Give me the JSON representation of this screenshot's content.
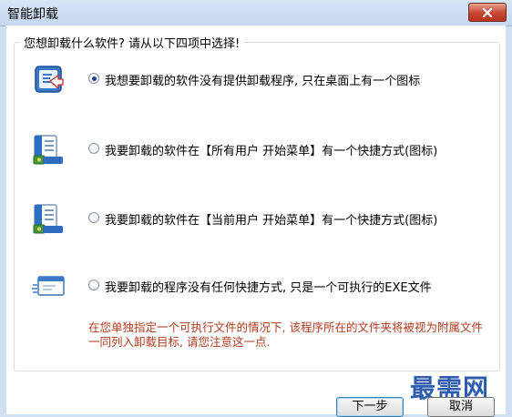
{
  "window": {
    "title": "智能卸载",
    "close_icon": "close-x-icon"
  },
  "dialog": {
    "question": "您想卸载什么软件? 请从以下四项中选择!",
    "options": [
      {
        "label": "我想要卸载的软件没有提供卸载程序, 只在桌面上有一个图标",
        "checked": true,
        "icon": "desktop-shortcut-icon"
      },
      {
        "label": "我要卸载的软件在【所有用户 开始菜单】有一个快捷方式(图标)",
        "checked": false,
        "icon": "start-menu-all-users-icon"
      },
      {
        "label": "我要卸载的软件在【当前用户 开始菜单】有一个快捷方式(图标)",
        "checked": false,
        "icon": "start-menu-current-user-icon"
      },
      {
        "label": "我要卸载的程序没有任何快捷方式, 只是一个可执行的EXE文件",
        "checked": false,
        "icon": "exe-window-icon"
      }
    ],
    "note": "在您单独指定一个可执行文件的情况下, 该程序所在的文件夹将被视为附属文件一同列入卸载目标, 请您注意这一点."
  },
  "buttons": {
    "next": "下一步",
    "cancel": "取消"
  },
  "watermark": "最需网",
  "colors": {
    "note_text": "#b13a1e",
    "radio_dot": "#1f3f8f",
    "close_button": "#c7442f",
    "watermark": "#2f5db0"
  }
}
